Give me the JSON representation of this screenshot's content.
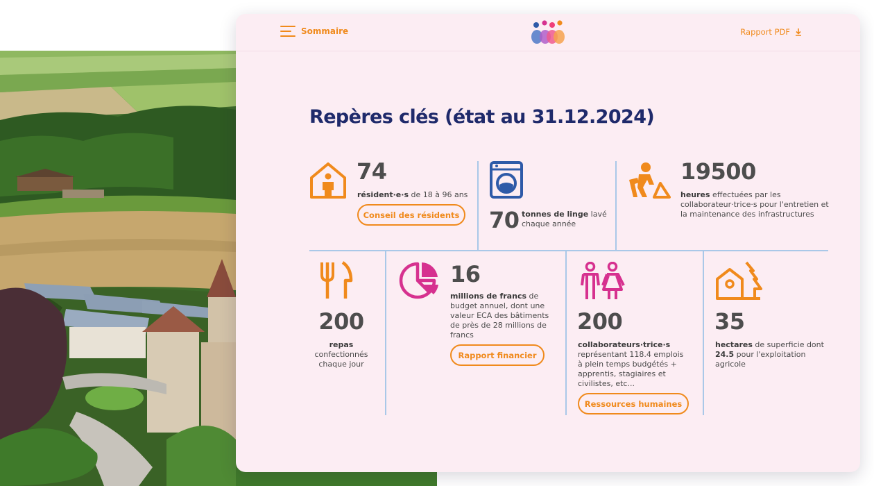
{
  "header": {
    "menu_label": "Sommaire",
    "pdf_label": "Rapport PDF"
  },
  "title": "Repères clés (état au 31.12.2024)",
  "stats": {
    "residents": {
      "number": "74",
      "bold": "résident·e·s",
      "text": " de 18 à 96 ans",
      "button": "Conseil des résidents"
    },
    "laundry": {
      "number": "70",
      "bold": "tonnes de linge",
      "text": " lavé chaque année"
    },
    "hours": {
      "number": "19500",
      "bold": "heures",
      "text": " effectuées par les collaborateur·trice·s pour l'entretien et la maintenance des infrastructures"
    },
    "meals": {
      "number": "200",
      "bold": "repas",
      "text": "confectionnés chaque jour"
    },
    "budget": {
      "number": "16",
      "bold": "millions de francs",
      "text": " de budget annuel, dont une valeur ECA des bâtiments de près de 28 millions de francs",
      "button": "Rapport financier"
    },
    "staff": {
      "number": "200",
      "bold": "collaborateurs·trice·s",
      "text": "représentant 118.4 emplois à plein temps budgétés + apprentis, stagiaires et civilistes, etc...",
      "button": "Ressources humaines"
    },
    "land": {
      "number": "35",
      "bold": "hectares",
      "text1": " de superficie dont ",
      "bold2": "24.5",
      "text2": " pour l'exploitation agricole"
    }
  },
  "colors": {
    "orange": "#f08a1c",
    "navy": "#1f2a6b",
    "blue_icon": "#2e5aa8",
    "magenta": "#d6318f",
    "card_bg": "#fcedf3",
    "divider": "#a9c8e8"
  },
  "icons": [
    "menu-icon",
    "logo",
    "download-icon",
    "house-person-icon",
    "washing-machine-icon",
    "worker-shovel-icon",
    "fork-knife-icon",
    "pie-chart-icon",
    "people-icon",
    "farm-tree-icon"
  ]
}
